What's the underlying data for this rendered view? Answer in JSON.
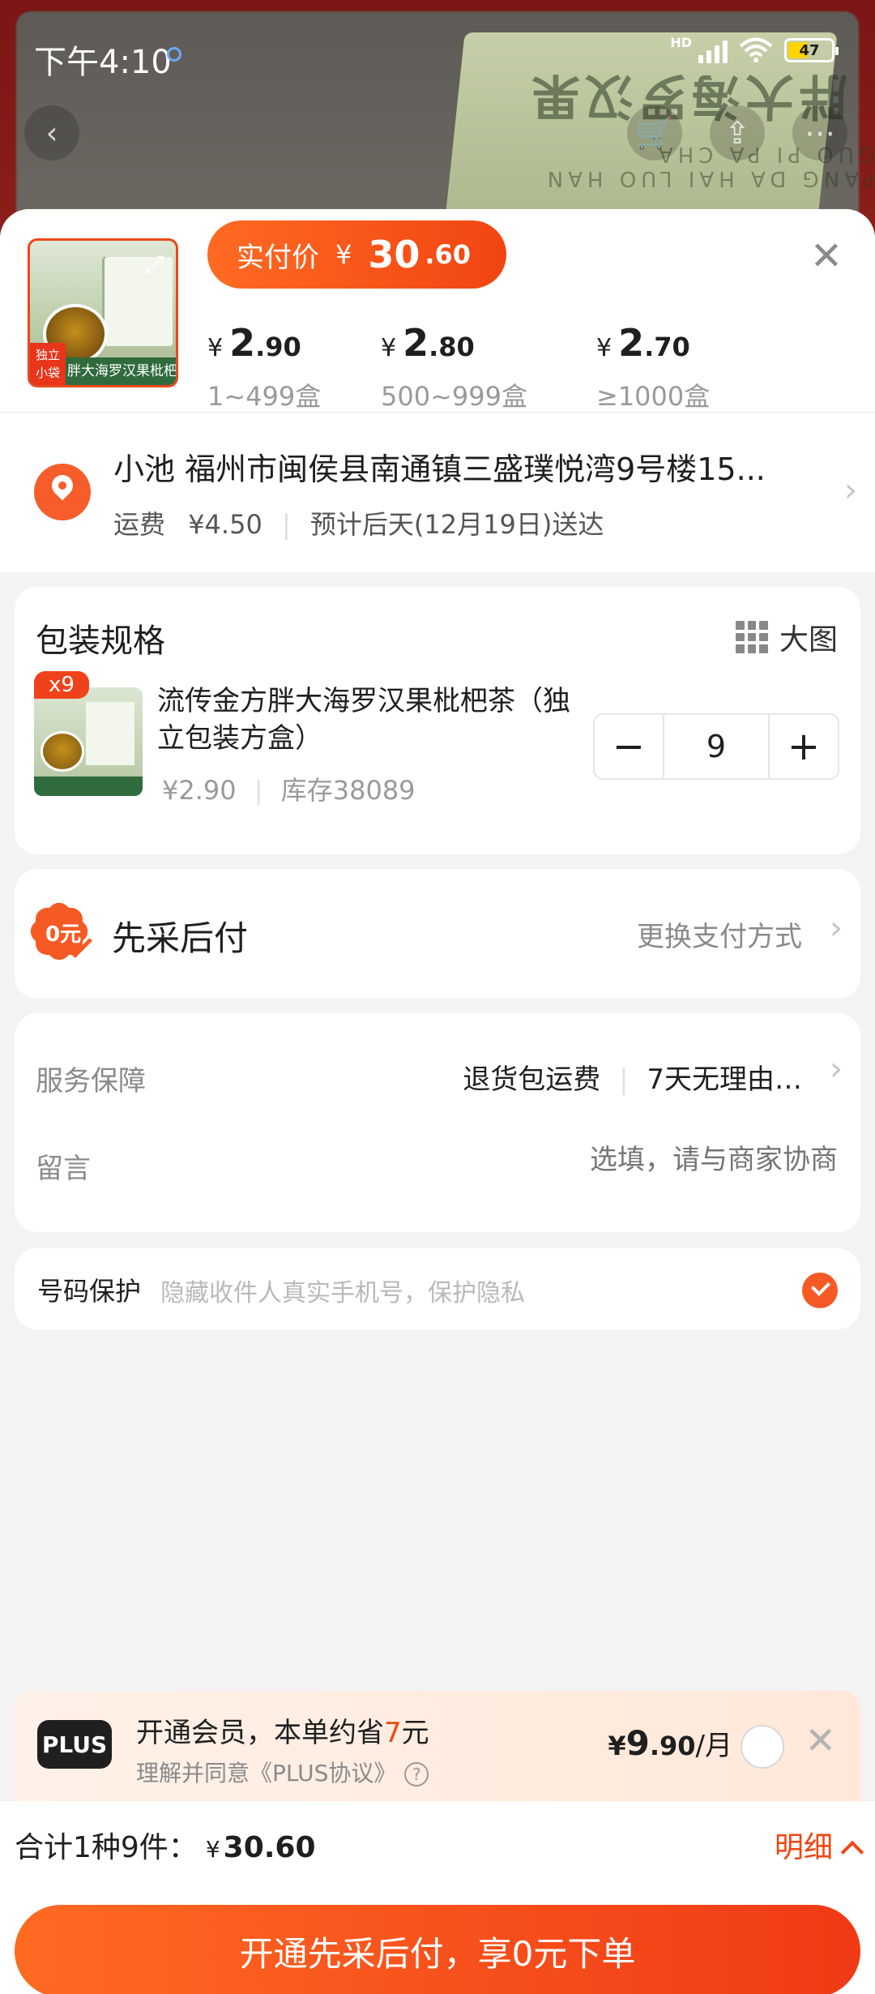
{
  "status_bar": {
    "time": "下午4:10",
    "network": "HD",
    "battery": "47"
  },
  "background": {
    "product_title": "胖大海罗汉果",
    "product_sub": "PANG DA HAI LUO HAN GUO PI PA CHA"
  },
  "header": {
    "thumbnail_label": "胖大海罗汉果枇杷茶",
    "thumbnail_tag": "独立小袋",
    "pay_label": "实付价",
    "pay_currency": "¥",
    "pay_int": "30",
    "pay_dec": ".60",
    "tiers": [
      {
        "currency": "¥",
        "int": "2",
        "dec": ".90",
        "range": "1~499盒"
      },
      {
        "currency": "¥",
        "int": "2",
        "dec": ".80",
        "range": "500~999盒"
      },
      {
        "currency": "¥",
        "int": "2",
        "dec": ".70",
        "range": "≥1000盒"
      }
    ]
  },
  "address": {
    "line": "小池 福州市闽侯县南通镇三盛璞悦湾9号楼15...",
    "shipping_label": "运费",
    "shipping_fee": "¥4.50",
    "eta": "预计后天(12月19日)送达"
  },
  "spec": {
    "title": "包装规格",
    "big_image_label": "大图",
    "badge": "x9",
    "product_name": "流传金方胖大海罗汉果枇杷茶（独立包装方盒）",
    "price": "¥2.90",
    "stock": "库存38089",
    "quantity": "9",
    "minus": "−",
    "plus": "+"
  },
  "payment": {
    "title": "先采后付",
    "icon_text": "0元",
    "change_label": "更换支付方式"
  },
  "service": {
    "label": "服务保障",
    "value1": "退货包运费",
    "value2": "7天无理由…",
    "message_label": "留言",
    "message_placeholder": "选填，请与商家协商"
  },
  "phone": {
    "label": "号码保护",
    "hint": "隐藏收件人真实手机号，保护隐私"
  },
  "plus": {
    "logo": "PLUS",
    "title_prefix": "开通会员，本单约省",
    "title_highlight": "7",
    "title_suffix": "元",
    "subtitle": "理解并同意《PLUS协议》",
    "price_currency": "¥",
    "price_int": "9",
    "price_dec": ".90",
    "price_unit": "/月"
  },
  "footer": {
    "total_label": "合计1种9件：",
    "total_currency": "¥",
    "total_value": "30.60",
    "detail_label": "明细",
    "cta_label": "开通先采后付，享0元下单"
  },
  "colors": {
    "accent": "#f24512",
    "accent_light": "#ff6a22",
    "plus_bg": "#fff1e8"
  }
}
